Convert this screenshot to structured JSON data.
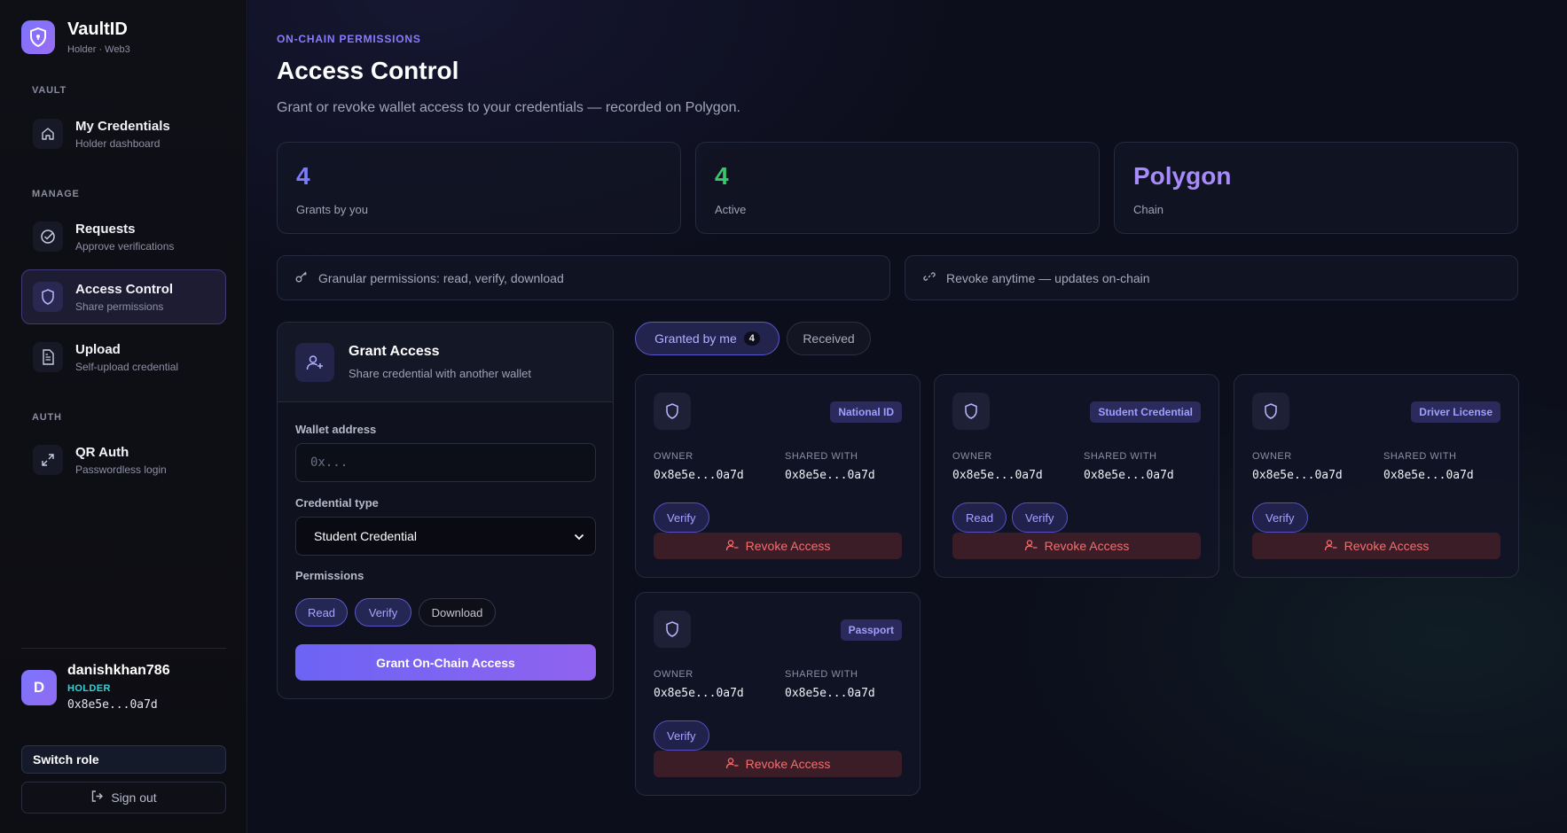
{
  "brand": {
    "name": "VaultID",
    "subtitle": "Holder · Web3"
  },
  "sidebar": {
    "sections": [
      "VAULT",
      "MANAGE",
      "AUTH"
    ],
    "items": [
      {
        "title": "My Credentials",
        "subtitle": "Holder dashboard",
        "icon": "home-icon"
      },
      {
        "title": "Requests",
        "subtitle": "Approve verifications",
        "icon": "check-circle-icon"
      },
      {
        "title": "Access Control",
        "subtitle": "Share permissions",
        "icon": "shield-icon",
        "active": true
      },
      {
        "title": "Upload",
        "subtitle": "Self-upload credential",
        "icon": "document-icon"
      },
      {
        "title": "QR Auth",
        "subtitle": "Passwordless login",
        "icon": "expand-icon"
      }
    ],
    "user": {
      "initial": "D",
      "name": "danishkhan786",
      "role": "HOLDER",
      "address": "0x8e5e...0a7d"
    },
    "switch_role": "Switch role",
    "sign_out": "Sign out"
  },
  "header": {
    "eyebrow": "ON-CHAIN PERMISSIONS",
    "title": "Access Control",
    "subtitle": "Grant or revoke wallet access to your credentials — recorded on Polygon."
  },
  "stats": [
    {
      "value": "4",
      "label": "Grants by you",
      "color": "#7b7cff"
    },
    {
      "value": "4",
      "label": "Active",
      "color": "#35c96b"
    },
    {
      "value": "Polygon",
      "label": "Chain",
      "color": "#a78bfa"
    }
  ],
  "info_bars": [
    {
      "icon": "key-icon",
      "text": "Granular permissions: read, verify, download"
    },
    {
      "icon": "link-icon",
      "text": "Revoke anytime — updates on-chain"
    }
  ],
  "grant_form": {
    "title": "Grant Access",
    "subtitle": "Share credential with another wallet",
    "wallet_label": "Wallet address",
    "wallet_placeholder": "0x...",
    "credential_label": "Credential type",
    "credential_selected": "Student Credential",
    "permissions_label": "Permissions",
    "permissions": [
      {
        "label": "Read",
        "selected": true
      },
      {
        "label": "Verify",
        "selected": true
      },
      {
        "label": "Download",
        "selected": false
      }
    ],
    "submit_label": "Grant On-Chain Access"
  },
  "tabs": {
    "granted_label": "Granted by me",
    "granted_count": "4",
    "received_label": "Received"
  },
  "card_labels": {
    "owner": "OWNER",
    "shared_with": "SHARED WITH",
    "revoke": "Revoke Access"
  },
  "cards": [
    {
      "badge": "National ID",
      "owner": "0x8e5e...0a7d",
      "shared_with": "0x8e5e...0a7d",
      "permissions": [
        "Verify"
      ]
    },
    {
      "badge": "Student Credential",
      "owner": "0x8e5e...0a7d",
      "shared_with": "0x8e5e...0a7d",
      "permissions": [
        "Read",
        "Verify"
      ]
    },
    {
      "badge": "Driver License",
      "owner": "0x8e5e...0a7d",
      "shared_with": "0x8e5e...0a7d",
      "permissions": [
        "Verify"
      ]
    },
    {
      "badge": "Passport",
      "owner": "0x8e5e...0a7d",
      "shared_with": "0x8e5e...0a7d",
      "permissions": [
        "Verify"
      ]
    }
  ]
}
